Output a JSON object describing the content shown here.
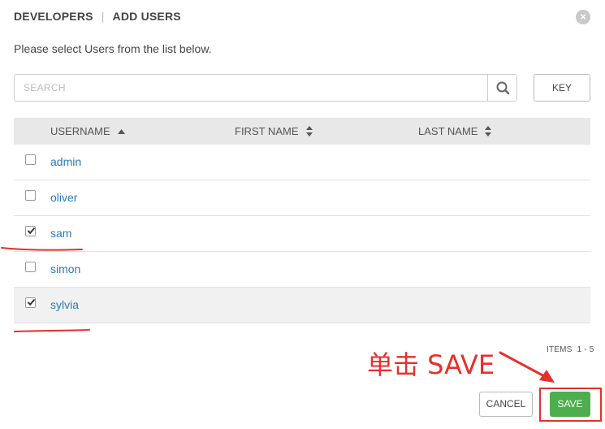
{
  "header": {
    "title": "DEVELOPERS",
    "subtitle": "ADD USERS"
  },
  "instruction": "Please select Users from the list below.",
  "search": {
    "placeholder": "SEARCH",
    "icon": "search-icon"
  },
  "key_button": "KEY",
  "table": {
    "columns": [
      {
        "label": "USERNAME",
        "sort": "ascending"
      },
      {
        "label": "FIRST NAME",
        "sort": "none"
      },
      {
        "label": "LAST NAME",
        "sort": "none"
      }
    ],
    "rows": [
      {
        "username": "admin",
        "first_name": "",
        "last_name": "",
        "checked": false
      },
      {
        "username": "oliver",
        "first_name": "",
        "last_name": "",
        "checked": false
      },
      {
        "username": "sam",
        "first_name": "",
        "last_name": "",
        "checked": true
      },
      {
        "username": "simon",
        "first_name": "",
        "last_name": "",
        "checked": false
      },
      {
        "username": "sylvia",
        "first_name": "",
        "last_name": "",
        "checked": true
      }
    ]
  },
  "pagination": {
    "items_label": "ITEMS",
    "range": "1 - 5"
  },
  "annotation": {
    "text": "单击 SAVE",
    "color": "#e5302b"
  },
  "footer": {
    "cancel": "CANCEL",
    "save": "SAVE"
  },
  "colors": {
    "link": "#2a7ab8",
    "save": "#4cae4c",
    "header_bg": "#e8e8e8"
  }
}
